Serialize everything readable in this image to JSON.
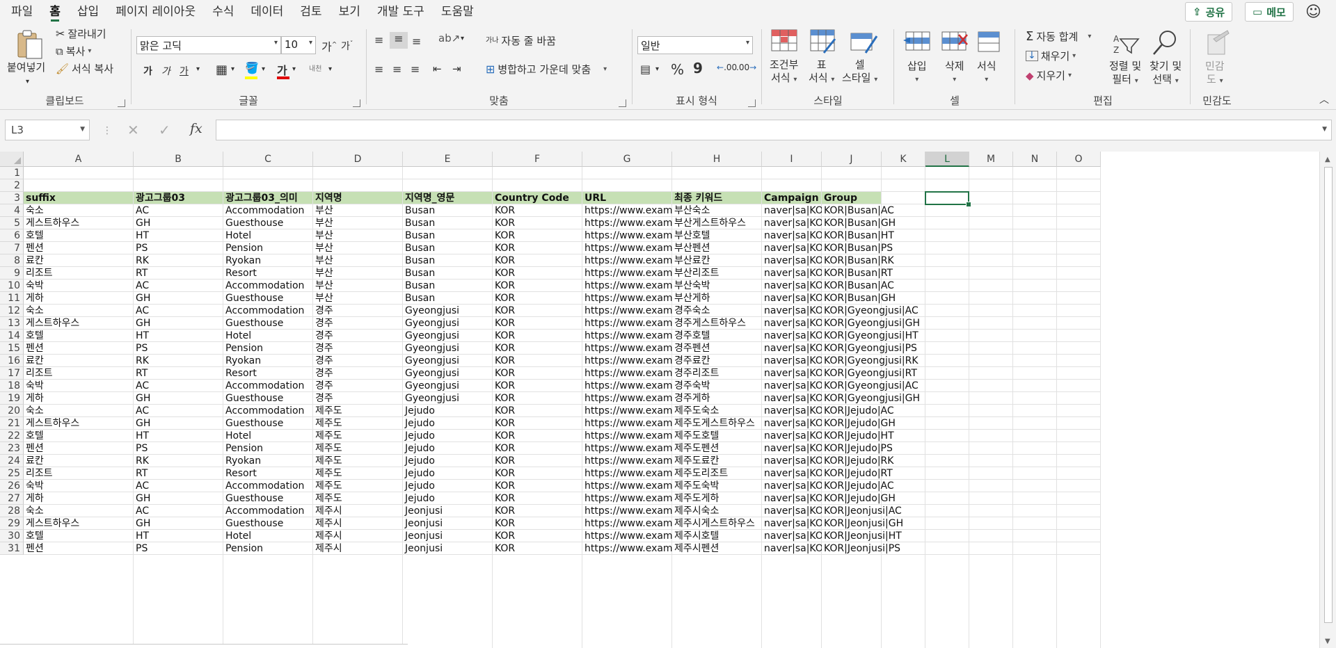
{
  "menu": {
    "tabs": [
      "파일",
      "홈",
      "삽입",
      "페이지 레이아웃",
      "수식",
      "데이터",
      "검토",
      "보기",
      "개발 도구",
      "도움말"
    ],
    "active_tab": "홈",
    "share_label": "공유",
    "memo_label": "메모"
  },
  "ribbon": {
    "clipboard": {
      "label": "클립보드",
      "paste": "붙여넣기",
      "cut": "잘라내기",
      "copy": "복사",
      "format_painter": "서식 복사"
    },
    "font": {
      "label": "글꼴",
      "font_name": "맑은 고딕",
      "font_size": "10",
      "bold": "가",
      "italic": "가",
      "underline": "가",
      "grow": "가",
      "shrink": "가",
      "phonetic": "내천",
      "font_color_glyph": "가"
    },
    "alignment": {
      "label": "맞춤",
      "wrap_text": "자동 줄 바꿈",
      "merge_center": "병합하고 가운데 맞춤",
      "orientation_glyph": "가나"
    },
    "number": {
      "label": "표시 형식",
      "format": "일반",
      "percent": "%",
      "comma": "9",
      "inc_decimal": ".00",
      "dec_decimal": ".00"
    },
    "styles": {
      "label": "스타일",
      "conditional": [
        "조건부",
        "서식"
      ],
      "table": [
        "표",
        "서식"
      ],
      "cell_styles": [
        "셀",
        "스타일"
      ]
    },
    "cells": {
      "label": "셀",
      "insert": "삽입",
      "delete": "삭제",
      "format": "서식"
    },
    "editing": {
      "label": "편집",
      "autosum": "자동 합계",
      "fill": "채우기",
      "clear": "지우기",
      "sort_filter": [
        "정렬 및",
        "필터"
      ],
      "find_select": [
        "찾기 및",
        "선택"
      ]
    },
    "sensitivity": {
      "label": "민감도",
      "button": [
        "민감",
        "도"
      ]
    }
  },
  "formula_bar": {
    "name_box": "L3",
    "formula": "",
    "fx": "fx"
  },
  "grid": {
    "columns": [
      "A",
      "B",
      "C",
      "D",
      "E",
      "F",
      "G",
      "H",
      "I",
      "J",
      "K",
      "L",
      "M",
      "N",
      "O"
    ],
    "selected_column": "L",
    "row_numbers": [
      "1",
      "2",
      "3",
      "4",
      "5",
      "6",
      "7",
      "8",
      "9",
      "10",
      "11",
      "12",
      "13",
      "14",
      "15",
      "16",
      "17",
      "18",
      "19",
      "20",
      "21",
      "22",
      "23",
      "24",
      "25",
      "26",
      "27",
      "28",
      "29",
      "30",
      "31"
    ],
    "header_row": [
      "suffix",
      "광고그룹03",
      "광고그룹03_의미",
      "지역명",
      "지역명_영문",
      "Country Code",
      "URL",
      "최종 키워드",
      "Campaign",
      "Group"
    ],
    "rows": [
      [
        "숙소",
        "AC",
        "Accommodation",
        "부산",
        "Busan",
        "KOR",
        "https://www.example.co.kr",
        "부산숙소",
        "naver|sa|KOR",
        "KOR|Busan|AC"
      ],
      [
        "게스트하우스",
        "GH",
        "Guesthouse",
        "부산",
        "Busan",
        "KOR",
        "https://www.example.co.kr",
        "부산게스트하우스",
        "naver|sa|KOR",
        "KOR|Busan|GH"
      ],
      [
        "호텔",
        "HT",
        "Hotel",
        "부산",
        "Busan",
        "KOR",
        "https://www.example.co.kr",
        "부산호텔",
        "naver|sa|KOR",
        "KOR|Busan|HT"
      ],
      [
        "펜션",
        "PS",
        "Pension",
        "부산",
        "Busan",
        "KOR",
        "https://www.example.co.kr",
        "부산펜션",
        "naver|sa|KOR",
        "KOR|Busan|PS"
      ],
      [
        "료칸",
        "RK",
        "Ryokan",
        "부산",
        "Busan",
        "KOR",
        "https://www.example.co.kr",
        "부산료칸",
        "naver|sa|KOR",
        "KOR|Busan|RK"
      ],
      [
        "리조트",
        "RT",
        "Resort",
        "부산",
        "Busan",
        "KOR",
        "https://www.example.co.kr",
        "부산리조트",
        "naver|sa|KOR",
        "KOR|Busan|RT"
      ],
      [
        "숙박",
        "AC",
        "Accommodation",
        "부산",
        "Busan",
        "KOR",
        "https://www.example.co.kr",
        "부산숙박",
        "naver|sa|KOR",
        "KOR|Busan|AC"
      ],
      [
        "게하",
        "GH",
        "Guesthouse",
        "부산",
        "Busan",
        "KOR",
        "https://www.example.co.kr",
        "부산게하",
        "naver|sa|KOR",
        "KOR|Busan|GH"
      ],
      [
        "숙소",
        "AC",
        "Accommodation",
        "경주",
        "Gyeongjusi",
        "KOR",
        "https://www.example.co.kr",
        "경주숙소",
        "naver|sa|KOR",
        "KOR|Gyeongjusi|AC"
      ],
      [
        "게스트하우스",
        "GH",
        "Guesthouse",
        "경주",
        "Gyeongjusi",
        "KOR",
        "https://www.example.co.kr",
        "경주게스트하우스",
        "naver|sa|KOR",
        "KOR|Gyeongjusi|GH"
      ],
      [
        "호텔",
        "HT",
        "Hotel",
        "경주",
        "Gyeongjusi",
        "KOR",
        "https://www.example.co.kr",
        "경주호텔",
        "naver|sa|KOR",
        "KOR|Gyeongjusi|HT"
      ],
      [
        "펜션",
        "PS",
        "Pension",
        "경주",
        "Gyeongjusi",
        "KOR",
        "https://www.example.co.kr",
        "경주펜션",
        "naver|sa|KOR",
        "KOR|Gyeongjusi|PS"
      ],
      [
        "료칸",
        "RK",
        "Ryokan",
        "경주",
        "Gyeongjusi",
        "KOR",
        "https://www.example.co.kr",
        "경주료칸",
        "naver|sa|KOR",
        "KOR|Gyeongjusi|RK"
      ],
      [
        "리조트",
        "RT",
        "Resort",
        "경주",
        "Gyeongjusi",
        "KOR",
        "https://www.example.co.kr",
        "경주리조트",
        "naver|sa|KOR",
        "KOR|Gyeongjusi|RT"
      ],
      [
        "숙박",
        "AC",
        "Accommodation",
        "경주",
        "Gyeongjusi",
        "KOR",
        "https://www.example.co.kr",
        "경주숙박",
        "naver|sa|KOR",
        "KOR|Gyeongjusi|AC"
      ],
      [
        "게하",
        "GH",
        "Guesthouse",
        "경주",
        "Gyeongjusi",
        "KOR",
        "https://www.example.co.kr",
        "경주게하",
        "naver|sa|KOR",
        "KOR|Gyeongjusi|GH"
      ],
      [
        "숙소",
        "AC",
        "Accommodation",
        "제주도",
        "Jejudo",
        "KOR",
        "https://www.example.co.kr",
        "제주도숙소",
        "naver|sa|KOR",
        "KOR|Jejudo|AC"
      ],
      [
        "게스트하우스",
        "GH",
        "Guesthouse",
        "제주도",
        "Jejudo",
        "KOR",
        "https://www.example.co.kr",
        "제주도게스트하우스",
        "naver|sa|KOR",
        "KOR|Jejudo|GH"
      ],
      [
        "호텔",
        "HT",
        "Hotel",
        "제주도",
        "Jejudo",
        "KOR",
        "https://www.example.co.kr",
        "제주도호텔",
        "naver|sa|KOR",
        "KOR|Jejudo|HT"
      ],
      [
        "펜션",
        "PS",
        "Pension",
        "제주도",
        "Jejudo",
        "KOR",
        "https://www.example.co.kr",
        "제주도펜션",
        "naver|sa|KOR",
        "KOR|Jejudo|PS"
      ],
      [
        "료칸",
        "RK",
        "Ryokan",
        "제주도",
        "Jejudo",
        "KOR",
        "https://www.example.co.kr",
        "제주도료칸",
        "naver|sa|KOR",
        "KOR|Jejudo|RK"
      ],
      [
        "리조트",
        "RT",
        "Resort",
        "제주도",
        "Jejudo",
        "KOR",
        "https://www.example.co.kr",
        "제주도리조트",
        "naver|sa|KOR",
        "KOR|Jejudo|RT"
      ],
      [
        "숙박",
        "AC",
        "Accommodation",
        "제주도",
        "Jejudo",
        "KOR",
        "https://www.example.co.kr",
        "제주도숙박",
        "naver|sa|KOR",
        "KOR|Jejudo|AC"
      ],
      [
        "게하",
        "GH",
        "Guesthouse",
        "제주도",
        "Jejudo",
        "KOR",
        "https://www.example.co.kr",
        "제주도게하",
        "naver|sa|KOR",
        "KOR|Jejudo|GH"
      ],
      [
        "숙소",
        "AC",
        "Accommodation",
        "제주시",
        "Jeonjusi",
        "KOR",
        "https://www.example.co.kr",
        "제주시숙소",
        "naver|sa|KOR",
        "KOR|Jeonjusi|AC"
      ],
      [
        "게스트하우스",
        "GH",
        "Guesthouse",
        "제주시",
        "Jeonjusi",
        "KOR",
        "https://www.example.co.kr",
        "제주시게스트하우스",
        "naver|sa|KOR",
        "KOR|Jeonjusi|GH"
      ],
      [
        "호텔",
        "HT",
        "Hotel",
        "제주시",
        "Jeonjusi",
        "KOR",
        "https://www.example.co.kr",
        "제주시호텔",
        "naver|sa|KOR",
        "KOR|Jeonjusi|HT"
      ],
      [
        "펜션",
        "PS",
        "Pension",
        "제주시",
        "Jeonjusi",
        "KOR",
        "https://www.example.co.kr",
        "제주시펜션",
        "naver|sa|KOR",
        "KOR|Jeonjusi|PS"
      ]
    ]
  }
}
